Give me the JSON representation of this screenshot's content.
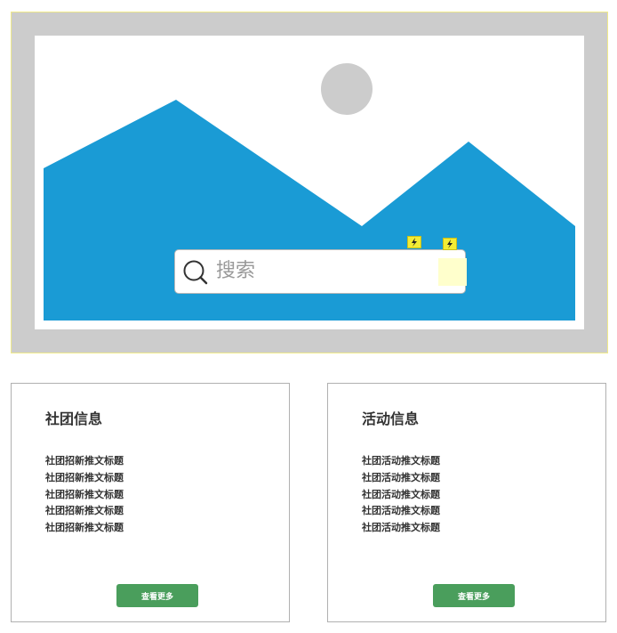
{
  "colors": {
    "hero_frame": "#cccccc",
    "mountains": "#1a9bd5",
    "sun": "#cccccc",
    "button": "#4a9e5c",
    "flash_hint": "#f3ec34"
  },
  "hero": {
    "image": "image-placeholder",
    "search": {
      "icon": "search-icon",
      "placeholder": "搜索"
    }
  },
  "club_info": {
    "title": "社团信息",
    "items": [
      "社团招新推文标题",
      "社团招新推文标题",
      "社团招新推文标题",
      "社团招新推文标题",
      "社团招新推文标题"
    ],
    "more_label": "查看更多"
  },
  "activity_info": {
    "title": "活动信息",
    "items": [
      "社团活动推文标题",
      "社团活动推文标题",
      "社团活动推文标题",
      "社团活动推文标题",
      "社团活动推文标题"
    ],
    "more_label": "查看更多"
  }
}
